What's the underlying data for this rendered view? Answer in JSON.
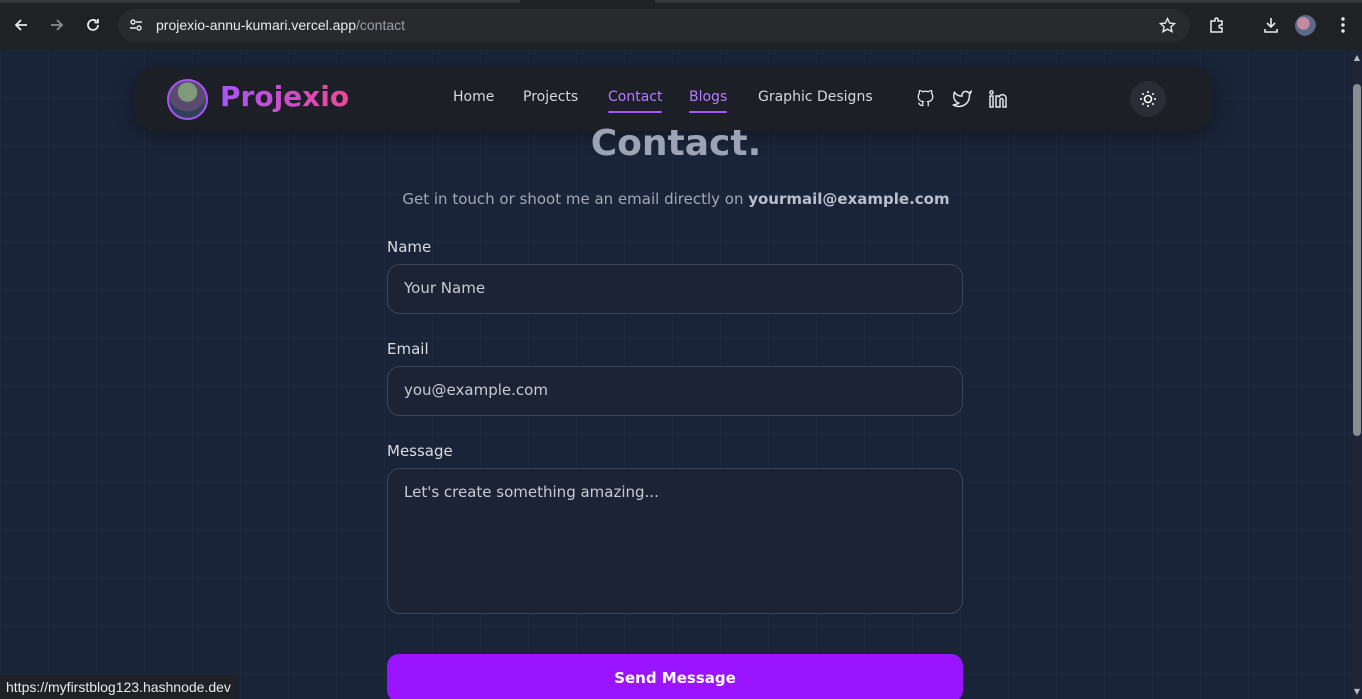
{
  "browser": {
    "url_host": "projexio-annu-kumari.vercel.app",
    "url_path": "/contact",
    "status_link": "https://myfirstblog123.hashnode.dev"
  },
  "navbar": {
    "brand": "Projexio",
    "links": [
      {
        "label": "Home",
        "active": false
      },
      {
        "label": "Projects",
        "active": false
      },
      {
        "label": "Contact",
        "active": true
      },
      {
        "label": "Blogs",
        "active": true
      },
      {
        "label": "Graphic Designs",
        "active": false
      }
    ],
    "social_icons": [
      "github-icon",
      "twitter-icon",
      "linkedin-icon"
    ],
    "theme_icon": "sun-icon"
  },
  "contact": {
    "heading": "Contact.",
    "subtitle_prefix": "Get in touch or shoot me an email directly on ",
    "email": "yourmail@example.com",
    "name_label": "Name",
    "name_placeholder": "Your Name",
    "email_label": "Email",
    "email_placeholder": "you@example.com",
    "message_label": "Message",
    "message_placeholder": "Let's create something amazing...",
    "submit_label": "Send Message"
  },
  "colors": {
    "accent": "#a855f7",
    "button": "#9a14ff",
    "brand_gradient_end": "#ec4899"
  }
}
